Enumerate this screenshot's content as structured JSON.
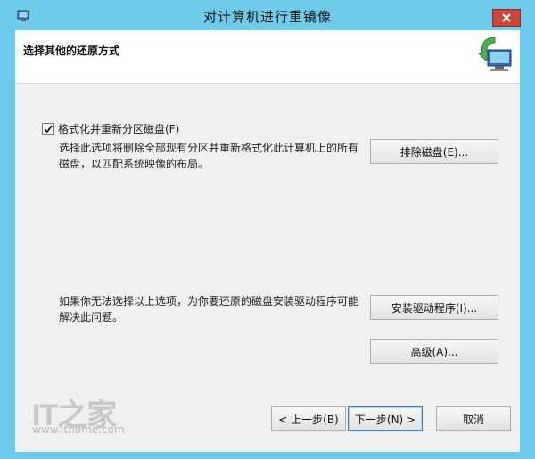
{
  "window": {
    "title": "对计算机进行重镜像"
  },
  "header": {
    "title": "选择其他的还原方式"
  },
  "option": {
    "label": "格式化并重新分区磁盘(F)",
    "checked": true,
    "description": "选择此选项将删除全部现有分区并重新格式化此计算机上的所有磁盘，以匹配系统映像的布局。"
  },
  "driver_hint": "如果你无法选择以上选项，为你要还原的磁盘安装驱动程序可能解决此问题。",
  "buttons": {
    "exclude_disks": "排除磁盘(E)...",
    "install_drivers": "安装驱动程序(I)...",
    "advanced": "高级(A)...",
    "back": "< 上一步(B)",
    "next": "下一步(N) >",
    "cancel": "取消"
  },
  "watermark": {
    "logo": "IT之家",
    "url": "www.ithome.com"
  },
  "colors": {
    "frame": "#6fcbea",
    "close": "#c7463d",
    "client": "#f0f0f0"
  }
}
